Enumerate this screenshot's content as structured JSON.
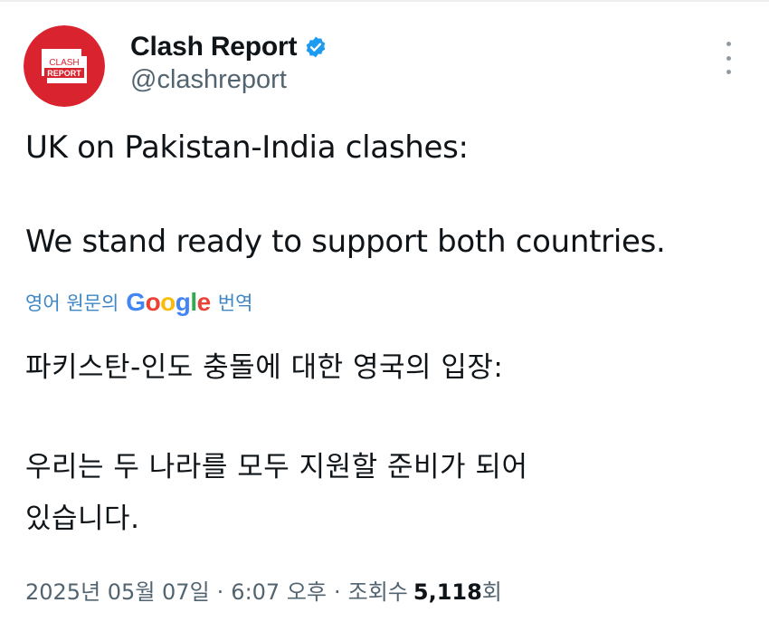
{
  "author": {
    "display_name": "Clash Report",
    "handle": "@clashreport",
    "avatar_icon": "clash-report-logo",
    "avatar_logo_text_top": "CLASH",
    "avatar_logo_text_bottom": "REPORT",
    "verified_icon": "verified-badge-icon",
    "verified_color": "#1d9bf0",
    "avatar_color": "#d9232e"
  },
  "more_icon": "more-vertical-icon",
  "tweet": {
    "text_line_1": "UK on Pakistan-India clashes:",
    "text_line_2": "We stand ready to support both countries."
  },
  "translation": {
    "label_prefix": "영어 원문의",
    "brand": "Google",
    "label_suffix": "번역",
    "link_color": "#3d86c6",
    "line_1": "파키스탄-인도 충돌에 대한 영국의 입장:",
    "line_2": "우리는 두 나라를 모두 지원할 준비가 되어",
    "line_3": "있습니다."
  },
  "meta": {
    "date": "2025년 05월 07일",
    "separator": "·",
    "time": "6:07 오후",
    "views_label": "조회수",
    "views_count": "5,118",
    "views_suffix": "회"
  }
}
